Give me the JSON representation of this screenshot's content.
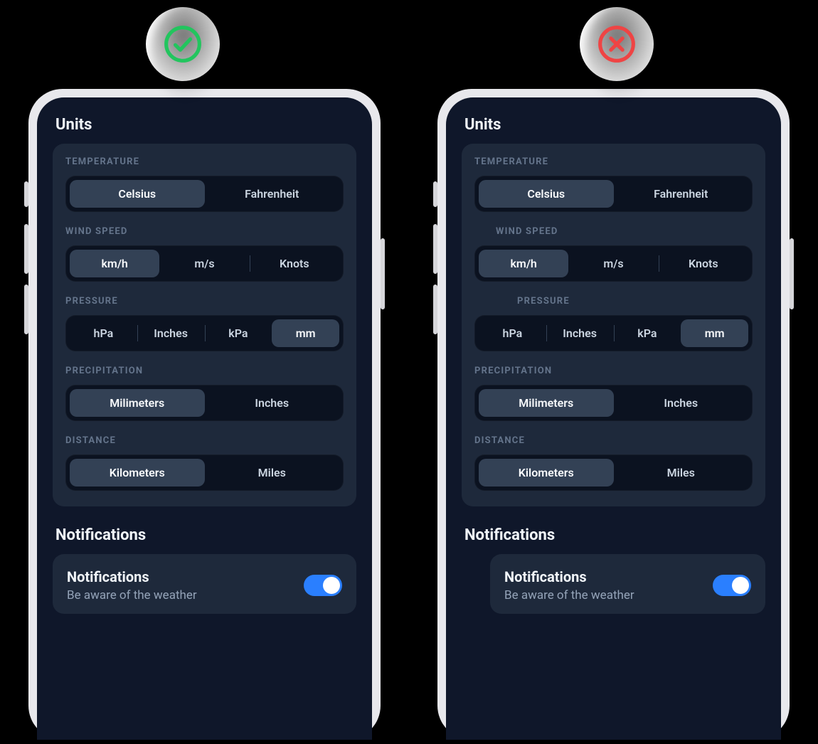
{
  "badges": {
    "good": "check",
    "bad": "cross"
  },
  "sections": {
    "units_title": "Units",
    "notifications_title": "Notifications"
  },
  "groups": {
    "temperature": {
      "label": "TEMPERATURE",
      "options": [
        "Celsius",
        "Fahrenheit"
      ],
      "selected": 0
    },
    "wind_speed": {
      "label": "WIND SPEED",
      "options": [
        "km/h",
        "m/s",
        "Knots"
      ],
      "selected": 0
    },
    "pressure": {
      "label": "PRESSURE",
      "options": [
        "hPa",
        "Inches",
        "kPa",
        "mm"
      ],
      "selected": 3
    },
    "precipitation": {
      "label": "PRECIPITATION",
      "options": [
        "Milimeters",
        "Inches"
      ],
      "selected": 0
    },
    "distance": {
      "label": "DISTANCE",
      "options": [
        "Kilometers",
        "Miles"
      ],
      "selected": 0
    }
  },
  "notifications": {
    "title": "Notifications",
    "subtitle": "Be aware of the weather",
    "enabled": true
  }
}
